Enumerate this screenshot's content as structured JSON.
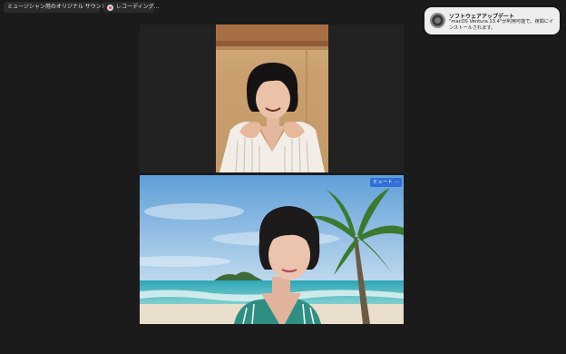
{
  "topbar": {
    "sound_label": "ミュージシャン用のオリジナル サウンド: オフ",
    "recording_label": "レコーディング..."
  },
  "notification": {
    "title": "ソフトウェアアップデート",
    "body": "\"macOS Ventura 13.4\"が利用可能で、夜間にインストールされます。"
  },
  "video_bottom": {
    "mute_label": "ミュート",
    "more_label": "···"
  },
  "colors": {
    "background": "#1b1b1b",
    "accent": "#2f6fd6"
  }
}
